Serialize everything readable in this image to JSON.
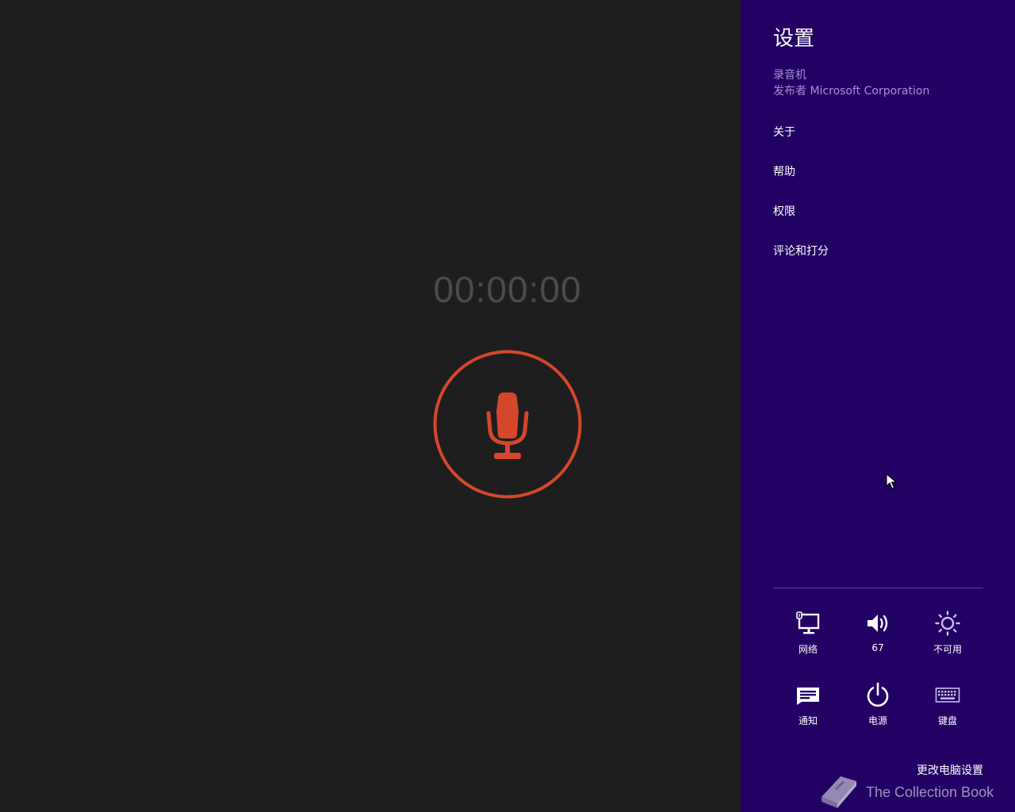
{
  "recorder": {
    "timer": "00:00:00",
    "accent_color": "#d5472b"
  },
  "charm": {
    "title": "设置",
    "app_name": "录音机",
    "publisher": "发布者 Microsoft Corporation",
    "items": [
      {
        "label": "关于"
      },
      {
        "label": "帮助"
      },
      {
        "label": "权限"
      },
      {
        "label": "评论和打分"
      }
    ],
    "tiles": [
      {
        "icon": "network-icon",
        "label": "网络"
      },
      {
        "icon": "volume-icon",
        "label": "67"
      },
      {
        "icon": "brightness-icon",
        "label": "不可用"
      },
      {
        "icon": "notifications-icon",
        "label": "通知"
      },
      {
        "icon": "power-icon",
        "label": "电源"
      },
      {
        "icon": "keyboard-icon",
        "label": "键盘"
      }
    ],
    "change_pc_settings": "更改电脑设置",
    "background_color": "#220064"
  },
  "watermark": {
    "text": "The Collection Book"
  }
}
